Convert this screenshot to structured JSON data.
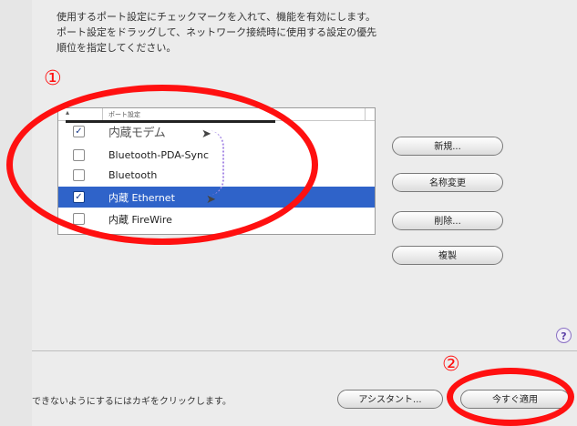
{
  "instructions": "使用するポート設定にチェックマークを入れて、機能を有効にします。\nポート設定をドラッグして、ネットワーク接続時に使用する設定の優先\n順位を指定してください。",
  "list": {
    "header": "ポート設定",
    "rows": [
      {
        "label": "内蔵モデム",
        "checked": true
      },
      {
        "label": "Bluetooth-PDA-Sync",
        "checked": false
      },
      {
        "label": "Bluetooth",
        "checked": false
      },
      {
        "label": "内蔵 Ethernet",
        "checked": true
      },
      {
        "label": "内蔵 FireWire",
        "checked": false
      }
    ]
  },
  "buttons": {
    "new": "新規...",
    "rename": "名称変更",
    "delete": "削除...",
    "duplicate": "複製"
  },
  "footer": {
    "lock_text": "できないようにするにはカギをクリックします。",
    "assistant": "アシスタント...",
    "apply": "今すぐ適用",
    "help": "?"
  },
  "annotations": {
    "marker1": "①",
    "marker2": "②",
    "color": "#ff1010"
  },
  "check_mark": "✓"
}
